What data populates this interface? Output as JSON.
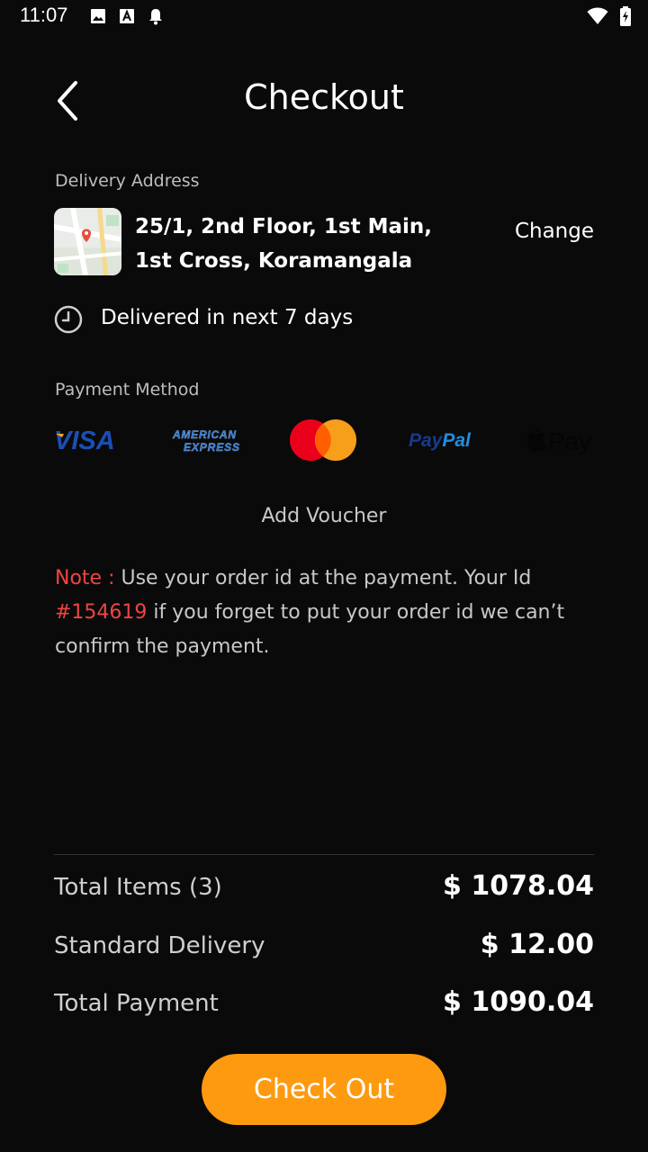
{
  "status": {
    "time": "11:07"
  },
  "header": {
    "title": "Checkout"
  },
  "delivery": {
    "label": "Delivery Address",
    "address": "25/1, 2nd Floor, 1st Main, 1st Cross, Koramangala",
    "change_label": "Change",
    "eta": "Delivered in next 7 days"
  },
  "payment": {
    "label": "Payment Method",
    "methods": [
      {
        "name": "VISA",
        "icon": "visa-icon"
      },
      {
        "name": "AMERICAN EXPRESS",
        "icon": "amex-icon"
      },
      {
        "name": "Mastercard",
        "icon": "mastercard-icon"
      },
      {
        "name": "PayPal",
        "icon": "paypal-icon"
      },
      {
        "name": "Pay",
        "icon": "apple-pay-icon"
      }
    ]
  },
  "voucher": {
    "label": "Add Voucher"
  },
  "note": {
    "prefix": "Note :",
    "text1": " Use your order id at the payment. Your Id ",
    "order_id": "#154619",
    "text2": " if you forget to put your order id we can’t confirm the payment."
  },
  "summary": {
    "rows": [
      {
        "label": "Total Items (3)",
        "value": "$ 1078.04"
      },
      {
        "label": "Standard Delivery",
        "value": "$ 12.00"
      },
      {
        "label": "Total Payment",
        "value": "$ 1090.04"
      }
    ]
  },
  "checkout": {
    "label": "Check Out"
  },
  "colors": {
    "accent": "#fd9a10",
    "note_red": "#ef4444",
    "background": "#0b0a0a"
  }
}
